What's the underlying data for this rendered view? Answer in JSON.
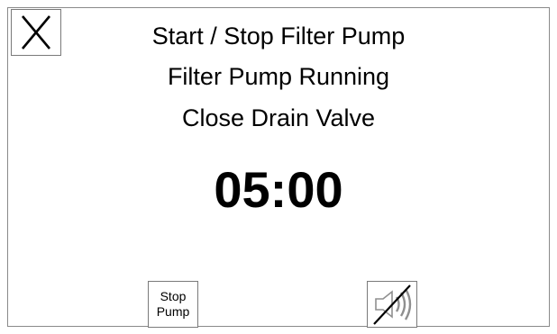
{
  "header": {
    "close_icon": "close-x-icon",
    "close_label": "X",
    "title": "Start / Stop Filter Pump"
  },
  "main": {
    "status": "Filter Pump Running",
    "instruction": "Close Drain Valve",
    "timer": "05:00"
  },
  "footer": {
    "stop_button": {
      "line1": "Stop",
      "line2": "Pump"
    },
    "mute_button": {
      "icon": "speaker-muted-icon"
    }
  }
}
